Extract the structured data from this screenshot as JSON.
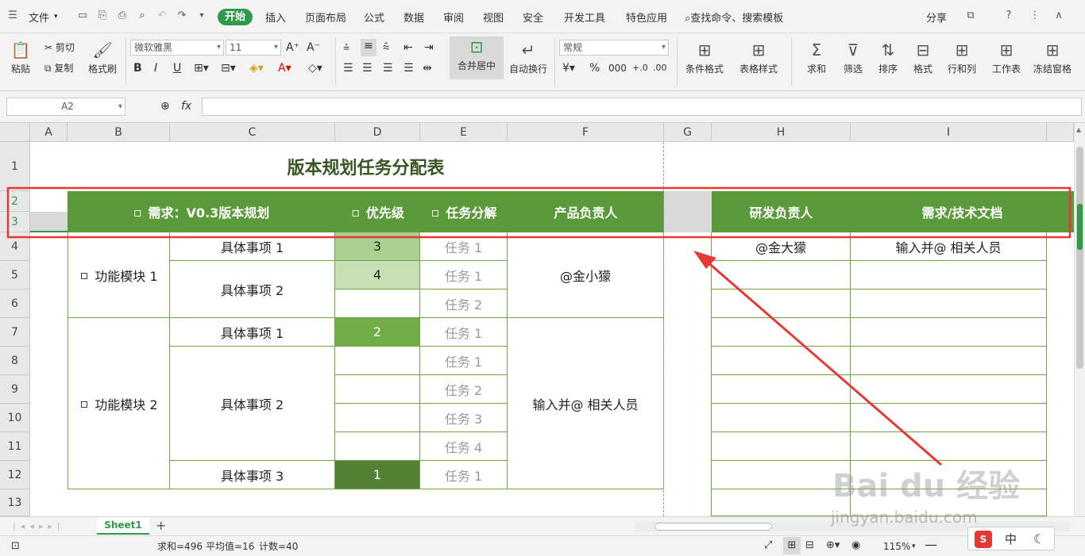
{
  "menu": {
    "file": "文件",
    "tabs": [
      "开始",
      "插入",
      "页面布局",
      "公式",
      "数据",
      "审阅",
      "视图",
      "安全",
      "开发工具",
      "特色应用"
    ],
    "search": "查找命令、搜索模板",
    "share": "分享"
  },
  "ribbon": {
    "paste": "粘贴",
    "cut": "剪切",
    "copy": "复制",
    "format_painter": "格式刷",
    "font_name": "微软雅黑",
    "font_size": "11",
    "merge": "合并居中",
    "wrap": "自动换行",
    "number_format": "常规",
    "cond_format": "条件格式",
    "table_style": "表格样式",
    "sum": "求和",
    "filter": "筛选",
    "sort": "排序",
    "format": "格式",
    "rowcol": "行和列",
    "worksheet": "工作表",
    "freeze": "冻结窗格",
    "bold": "B",
    "italic": "I",
    "underline": "U"
  },
  "formula_bar": {
    "name_box": "A2",
    "fx": "fx",
    "value": ""
  },
  "columns": [
    "A",
    "B",
    "C",
    "D",
    "E",
    "F",
    "G",
    "H",
    "I"
  ],
  "rows": [
    "1",
    "2",
    "3",
    "4",
    "5",
    "6",
    "7",
    "8",
    "9",
    "10",
    "11",
    "12",
    "13"
  ],
  "sheet": {
    "title": "版本规划任务分配表",
    "headers": {
      "req": "需求：V0.3版本规划",
      "priority": "优先级",
      "task": "任务分解",
      "pm": "产品负责人",
      "dev": "研发负责人",
      "doc": "需求/技术文档"
    },
    "module1": "功能模块 1",
    "module2": "功能模块 2",
    "item1": "具体事项 1",
    "item2": "具体事项 2",
    "item3": "具体事项 3",
    "prio": [
      "3",
      "4",
      "2",
      "1"
    ],
    "tasks": [
      "任务 1",
      "任务 1",
      "任务 2",
      "任务 1",
      "任务 1",
      "任务 2",
      "任务 3",
      "任务 4",
      "任务 1"
    ],
    "pm1": "@金小獴",
    "pm2": "输入并@ 相关人员",
    "dev1": "@金大獴",
    "doc1": "输入并@ 相关人员"
  },
  "tabs": {
    "sheet1": "Sheet1",
    "add": "+"
  },
  "status": {
    "sum": "求和=496",
    "avg": "平均值=16",
    "count": "计数=40",
    "zoom": "115%"
  },
  "ime": {
    "s": "S",
    "zh": "中"
  },
  "watermark": {
    "brand": "Bai du 经验",
    "url": "jingyan.baidu.com"
  },
  "colors": {
    "header_green": "#5b9a3a",
    "prio3": "#a9d08e",
    "prio4": "#c6e0b4",
    "prio2": "#70ad47",
    "prio1": "#548235",
    "annot_red": "#e53935"
  }
}
